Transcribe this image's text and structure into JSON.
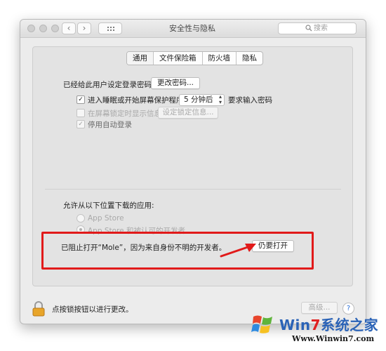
{
  "window": {
    "title": "安全性与隐私",
    "search_placeholder": "搜索",
    "nav_back": "‹",
    "nav_forward": "›"
  },
  "tabs": [
    "通用",
    "文件保险箱",
    "防火墙",
    "隐私"
  ],
  "general": {
    "password_set_label": "已经给此用户设定登录密码",
    "change_password_button": "更改密码...",
    "require_password_label": "进入睡眠或开始屏幕保护程序",
    "require_password_delay": "5 分钟后",
    "require_password_suffix": "要求输入密码",
    "show_message_label": "在屏幕锁定时显示信息",
    "set_lock_message_button": "设定锁定信息...",
    "disable_autologin_label": "停用自动登录",
    "checkmark": "✓"
  },
  "downloads": {
    "heading": "允许从以下位置下载的应用:",
    "option_app_store": "App Store",
    "option_identified": "App Store 和被认可的开发者",
    "blocked_message": "已阻止打开“Mole”，因为来自身份不明的开发者。",
    "open_anyway_button": "仍要打开"
  },
  "footer": {
    "lock_label": "点按锁按钮以进行更改。",
    "advanced_button": "高级...",
    "help_glyph": "?"
  },
  "watermark": {
    "brand_part1": "Win",
    "brand_part2": "7",
    "brand_part3": "系统之家",
    "url": "Www.Winwin7.com"
  },
  "colors": {
    "highlight": "#e11a1a",
    "link_blue": "#2a6fd6"
  }
}
